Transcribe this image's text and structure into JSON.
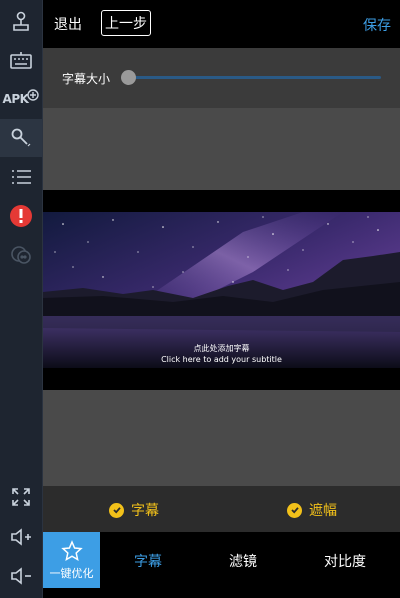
{
  "toolbar": {
    "exit_label": "退出",
    "prev_label": "上一步",
    "save_label": "保存"
  },
  "subtitle_size": {
    "label": "字幕大小",
    "value": 0
  },
  "preview": {
    "subtitle_cn": "点此处添加字幕",
    "subtitle_en": "Click here to add your subtitle"
  },
  "options": [
    {
      "label": "字幕",
      "checked": true
    },
    {
      "label": "遮幅",
      "checked": true
    }
  ],
  "bottom": {
    "oneclick_label": "一键优化",
    "tabs": [
      {
        "label": "字幕",
        "active": true
      },
      {
        "label": "滤镜",
        "active": false
      },
      {
        "label": "对比度",
        "active": false
      }
    ]
  },
  "side_tools": {
    "apk_label": "APK"
  },
  "colors": {
    "accent": "#3d9ee5",
    "check": "#f2c11a"
  }
}
